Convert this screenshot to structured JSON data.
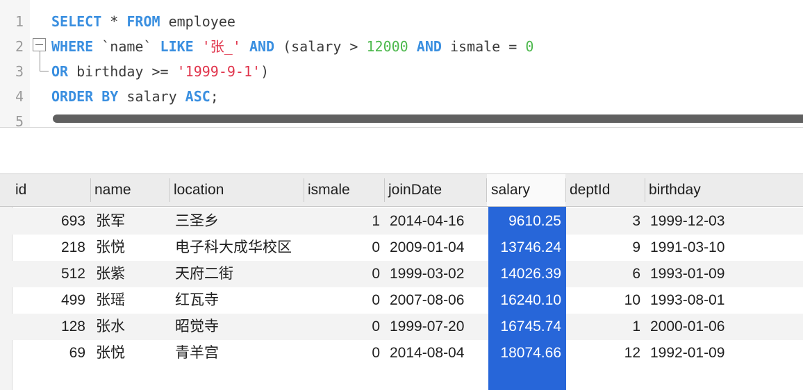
{
  "editor": {
    "line_numbers": [
      "1",
      "2",
      "3",
      "4",
      "5"
    ],
    "line1": {
      "kw1": "SELECT",
      "op": " * ",
      "kw2": "FROM",
      "rest": " employee"
    },
    "line2": {
      "kw1": "WHERE",
      "t1": " `name` ",
      "kw2": "LIKE",
      "sp1": " ",
      "str": "'张_'",
      "sp2": " ",
      "kw3": "AND",
      "t2": " (salary > ",
      "num1": "12000",
      "sp3": " ",
      "kw4": "AND",
      "t3": " ismale = ",
      "num2": "0"
    },
    "line3": {
      "kw1": "OR",
      "t1": " birthday >= ",
      "str": "'1999-9-1'",
      "t2": ")"
    },
    "line4": {
      "kw1": "ORDER BY",
      "t1": " salary ",
      "kw2": "ASC",
      "t2": ";"
    }
  },
  "grid": {
    "columns": [
      "id",
      "name",
      "location",
      "ismale",
      "joinDate",
      "salary",
      "deptId",
      "birthday"
    ],
    "selected_column": "salary",
    "rows": [
      {
        "id": "693",
        "name": "张军",
        "location": "三圣乡",
        "ismale": "1",
        "joinDate": "2014-04-16",
        "salary": "9610.25",
        "deptId": "3",
        "birthday": "1999-12-03"
      },
      {
        "id": "218",
        "name": "张悦",
        "location": "电子科大成华校区",
        "ismale": "0",
        "joinDate": "2009-01-04",
        "salary": "13746.24",
        "deptId": "9",
        "birthday": "1991-03-10"
      },
      {
        "id": "512",
        "name": "张紫",
        "location": "天府二街",
        "ismale": "0",
        "joinDate": "1999-03-02",
        "salary": "14026.39",
        "deptId": "6",
        "birthday": "1993-01-09"
      },
      {
        "id": "499",
        "name": "张瑶",
        "location": "红瓦寺",
        "ismale": "0",
        "joinDate": "2007-08-06",
        "salary": "16240.10",
        "deptId": "10",
        "birthday": "1993-08-01"
      },
      {
        "id": "128",
        "name": "张水",
        "location": "昭觉寺",
        "ismale": "0",
        "joinDate": "1999-07-20",
        "salary": "16745.74",
        "deptId": "1",
        "birthday": "2000-01-06"
      },
      {
        "id": "69",
        "name": "张悦",
        "location": "青羊宫",
        "ismale": "0",
        "joinDate": "2014-08-04",
        "salary": "18074.66",
        "deptId": "12",
        "birthday": "1992-01-09"
      }
    ]
  },
  "colors": {
    "keyword": "#3a8fe0",
    "number": "#4cb84c",
    "string": "#e0334b",
    "selection": "#2766d9"
  }
}
